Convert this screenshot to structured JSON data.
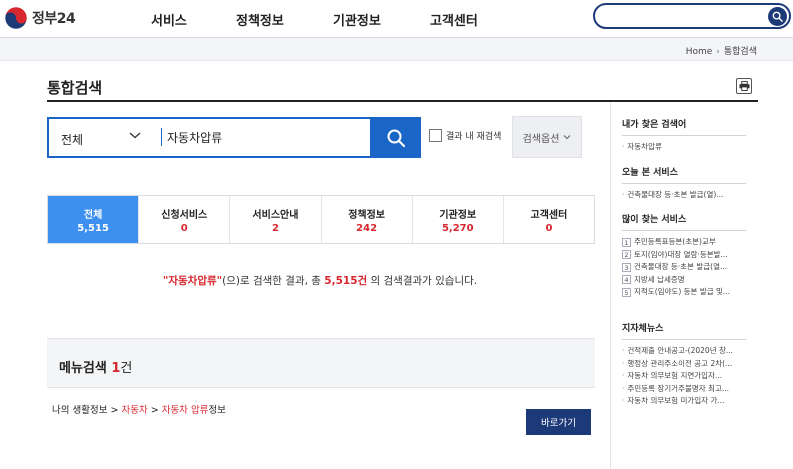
{
  "header": {
    "logo_text": "정부24",
    "nav": [
      "서비스",
      "정책정보",
      "기관정보",
      "고객센터"
    ],
    "search_value": ""
  },
  "breadcrumb": [
    "Home",
    "통합검색"
  ],
  "page": {
    "title": "통합검색"
  },
  "search": {
    "category": "전체",
    "query": "자동차압류",
    "re_search_label": "결과 내 재검색",
    "options_label": "검색옵션"
  },
  "tabs": [
    {
      "label": "전체",
      "count": "5,515",
      "active": true
    },
    {
      "label": "신청서비스",
      "count": "0"
    },
    {
      "label": "서비스안내",
      "count": "2"
    },
    {
      "label": "정책정보",
      "count": "242"
    },
    {
      "label": "기관정보",
      "count": "5,270"
    },
    {
      "label": "고객센터",
      "count": "0"
    }
  ],
  "result": {
    "keyword_display": "\"자동차압류\"",
    "text_1": "(으)로 검색한 결과, 총 ",
    "total": "5,515건",
    "text_2": " 의 검색결과가 있습니다."
  },
  "menu_search": {
    "title": "메뉴검색",
    "count": "1",
    "unit": "건",
    "path_1": "나의 생활정보 > ",
    "path_2": "자동차",
    "path_3": " > ",
    "path_4": "자동차 압류",
    "path_5": "정보",
    "go_button": "바로가기"
  },
  "sidebar": {
    "recent_searches": {
      "title": "내가 찾은 검색어",
      "items": [
        "자동차압류"
      ]
    },
    "today_services": {
      "title": "오늘 본 서비스",
      "items": [
        "건축물대장 등·초본 발급(열)..."
      ]
    },
    "popular_services": {
      "title": "많이 찾는 서비스",
      "items": [
        "주민등록표등본(초본)교부",
        "토지(임야)대장 열람·등본발...",
        "건축물대장 등·초본 발급(열...",
        "지방세 납세증명",
        "지적도(임야도) 등본 발급 및..."
      ]
    },
    "local_news": {
      "title": "지자체뉴스",
      "items": [
        "건적제출 안내공고-(2020년 창...",
        "행정상 관리주소이전 공고 2차(...",
        "자동차 의무보험 지연가입자...",
        "주민등록 장기거주불명자 최고...",
        "자동차 의무보험 미가입자 가..."
      ]
    }
  },
  "colors": {
    "brand_navy": "#1d3a78",
    "search_blue": "#1a66c8",
    "active_tab": "#3d8ff0",
    "accent_red": "#d7282f"
  }
}
